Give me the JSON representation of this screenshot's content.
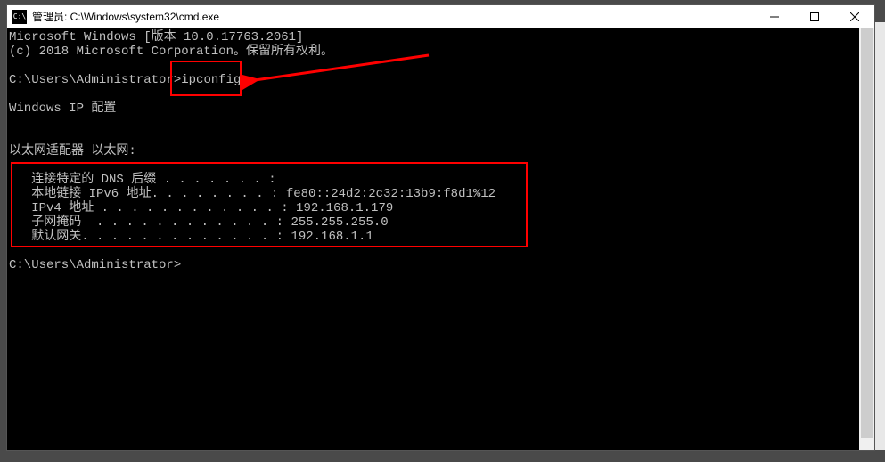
{
  "titlebar": {
    "icon_label": "C:\\",
    "title": "管理员: C:\\Windows\\system32\\cmd.exe"
  },
  "terminal": {
    "line1": "Microsoft Windows [版本 10.0.17763.2061]",
    "line2": "(c) 2018 Microsoft Corporation。保留所有权利。",
    "blank1": " ",
    "prompt1_prefix": "C:\\Users\\Administrator>",
    "prompt1_cmd": "ipconfig",
    "blank2": " ",
    "ipcfg_header": "Windows IP 配置",
    "blank3": " ",
    "blank4": " ",
    "adapter_header": "以太网适配器 以太网:",
    "blank5": " ",
    "dns_suffix": "   连接特定的 DNS 后缀 . . . . . . . :",
    "ipv6": "   本地链接 IPv6 地址. . . . . . . . : fe80::24d2:2c32:13b9:f8d1%12",
    "ipv4": "   IPv4 地址 . . . . . . . . . . . . : 192.168.1.179",
    "subnet": "   子网掩码  . . . . . . . . . . . . : 255.255.255.0",
    "gateway": "   默认网关. . . . . . . . . . . . . : 192.168.1.1",
    "blank6": " ",
    "prompt2": "C:\\Users\\Administrator>"
  }
}
